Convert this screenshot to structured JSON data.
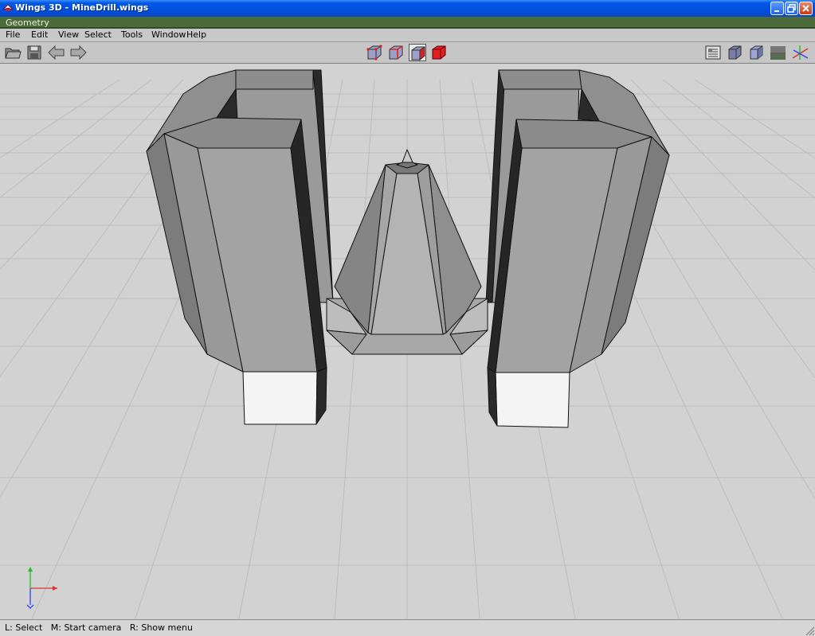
{
  "window": {
    "title": "Wings 3D - MineDrill.wings"
  },
  "geometry_label": "Geometry",
  "menu": [
    {
      "label": "File"
    },
    {
      "label": "Edit"
    },
    {
      "label": "View"
    },
    {
      "label": "Select"
    },
    {
      "label": "Tools"
    },
    {
      "label": "Window"
    },
    {
      "label": "Help"
    }
  ],
  "toolbar": {
    "left_icons": [
      "open-folder-icon",
      "save-icon",
      "undo-arrow-icon",
      "redo-arrow-icon"
    ],
    "selection_modes": [
      "vertex-mode",
      "edge-mode",
      "face-mode",
      "body-mode"
    ],
    "active_selection_mode": "face-mode",
    "right_icons": [
      "groundplane-icon",
      "smooth-preview-icon",
      "shaded-cube-icon",
      "workmode-icon",
      "axes-icon"
    ]
  },
  "status": {
    "text": "L: Select   M: Start camera   R: Show menu"
  },
  "colors": {
    "titlebar": "#0058e6",
    "geometry_strip": "#4c6b3a",
    "viewport_bg": "#d2d2d2",
    "grid_line": "#bcbcbc",
    "axis_x": "#e03030",
    "axis_y": "#20c020",
    "axis_z": "#3040ff",
    "body_mode_accent": "#e02020"
  }
}
